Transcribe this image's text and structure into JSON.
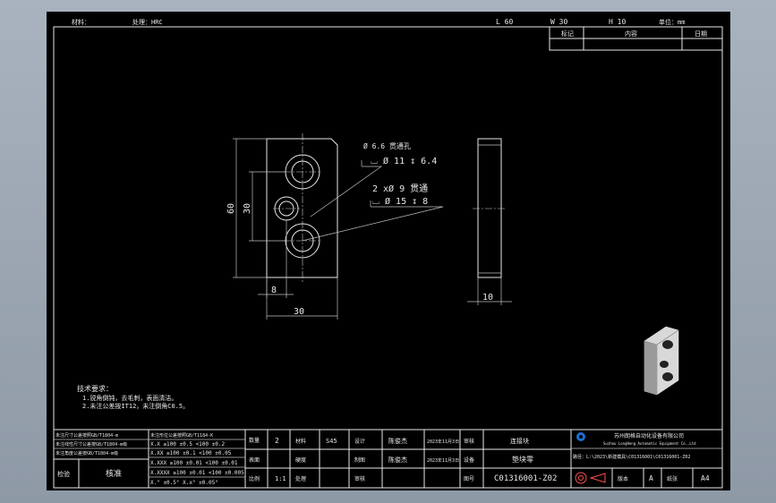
{
  "header": {
    "top_left_a": "材料：",
    "top_left_b": "处理：HRC",
    "length_label": "L 60",
    "width_label": "W 30",
    "height_label": "H 10",
    "unit_label": "单位：mm"
  },
  "revision_table": {
    "col_mark": "标记",
    "col_content": "内容",
    "col_date": "日期"
  },
  "part": {
    "hole_note_1a": "Ø 6.6 贯通孔",
    "hole_note_1b": "⌴ Ø 11 ↧ 6.4",
    "hole_note_2a": "2 xØ 9 贯通",
    "hole_note_2b": "⌴ Ø 15 ↧ 8",
    "dim_60": "60",
    "dim_30_vertical": "30",
    "dim_8": "8",
    "dim_30_horizontal": "30",
    "dim_10": "10"
  },
  "notes": {
    "title": "技术要求：",
    "line1": "1.锐角倒钝，去毛刺，表面清洁。",
    "line2": "2.未注公差按IT12，未注倒角C0.5。"
  },
  "tolerance_table": {
    "hdr_left": "未注尺寸公差按照GB/T1804-m",
    "hdr_right": "未注形位公差按照GB/T1184-K",
    "left_r1": "未注线性尺寸公差按GB/T1804-m级",
    "left_r2": "未注角度公差按GB/T1804-m级",
    "rows": [
      "X.X   ≥100 ±0.5   <100 ±0.2",
      "X.XX  ≥100 ±0.1   <100 ±0.05",
      "X.XXX ≥100 ±0.01  <100 ±0.01",
      "X.XXXX ≥100 ±0.01 <100 ±0.005",
      "X.°  ±0.5°     X.x° ±0.05°"
    ],
    "cert_label": "检验",
    "cert_value": "核准"
  },
  "title_block": {
    "qty_label": "数量",
    "qty_value": "2",
    "material_label": "材料",
    "material_value": "S45",
    "design_label": "设计",
    "designer": "陈俊杰",
    "design_date": "2023年11月3日",
    "approve_label": "审核",
    "drawn_label": "制图",
    "checker": "陈俊杰",
    "check_date": "2023年11月3日",
    "proj_label": "设备",
    "hardness_label": "硬度",
    "surface_label": "表面",
    "scale_label": "比例",
    "scale_value": "1:1",
    "treat_label": "处理",
    "audit_label": "审核",
    "review_label": "审核",
    "part_name_top": "连接块",
    "part_name": "垫块零",
    "drawing_no_label": "图号",
    "drawing_no": "C01316001-Z02",
    "company_cn": "苏州朗格自动化设备有限公司",
    "company_en": "Suzhou LongHong Automatic Equipment Co.,Ltd",
    "path": "路径：L:\\2023\\新建模具\\C01316001\\C01316001-Z02",
    "version_label": "版本",
    "version_value": "A",
    "size_label": "纸张",
    "size_value": "A4"
  }
}
